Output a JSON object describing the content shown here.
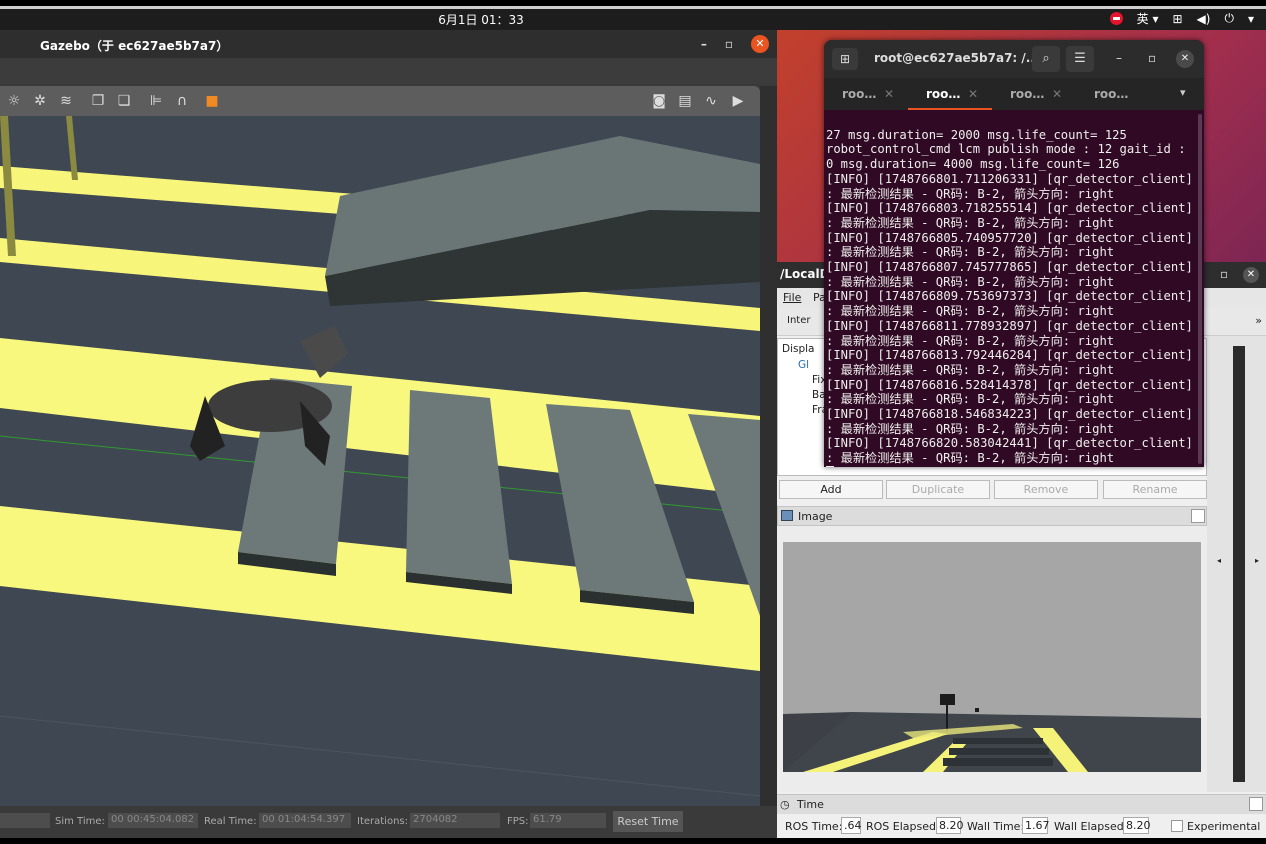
{
  "topbar": {
    "datetime": "6月1日  01：33",
    "input_method": "英 ▾"
  },
  "gazebo": {
    "title": "Gazebo（于 ec627ae5b7a7）",
    "bottom": {
      "sim_time_label": "Sim Time:",
      "sim_time": "00 00:45:04.082",
      "real_time_label": "Real Time:",
      "real_time": "00 01:04:54.397",
      "iterations_label": "Iterations:",
      "iterations": "2704082",
      "fps_label": "FPS:",
      "fps": "61.79",
      "reset_label": "Reset Time"
    }
  },
  "terminal": {
    "title": "root@ec627ae5b7a7: /...",
    "tabs": [
      {
        "label": "roo…"
      },
      {
        "label": "roo…"
      },
      {
        "label": "roo…"
      },
      {
        "label": "roo…"
      }
    ],
    "lines": [
      "27 msg.duration= 2000 msg.life_count= 125",
      "robot_control_cmd lcm publish mode : 12 gait_id :",
      "0 msg.duration= 4000 msg.life_count= 126",
      "[INFO] [1748766801.711206331] [qr_detector_client]",
      ": 最新检测结果 - QR码: B-2, 箭头方向: right",
      "[INFO] [1748766803.718255514] [qr_detector_client]",
      ": 最新检测结果 - QR码: B-2, 箭头方向: right",
      "[INFO] [1748766805.740957720] [qr_detector_client]",
      ": 最新检测结果 - QR码: B-2, 箭头方向: right",
      "[INFO] [1748766807.745777865] [qr_detector_client]",
      ": 最新检测结果 - QR码: B-2, 箭头方向: right",
      "[INFO] [1748766809.753697373] [qr_detector_client]",
      ": 最新检测结果 - QR码: B-2, 箭头方向: right",
      "[INFO] [1748766811.778932897] [qr_detector_client]",
      ": 最新检测结果 - QR码: B-2, 箭头方向: right",
      "[INFO] [1748766813.792446284] [qr_detector_client]",
      ": 最新检测结果 - QR码: B-2, 箭头方向: right",
      "[INFO] [1748766816.528414378] [qr_detector_client]",
      ": 最新检测结果 - QR码: B-2, 箭头方向: right",
      "[INFO] [1748766818.546834223] [qr_detector_client]",
      ": 最新检测结果 - QR码: B-2, 箭头方向: right",
      "[INFO] [1748766820.583042441] [qr_detector_client]",
      ": 最新检测结果 - QR码: B-2, 箭头方向: right"
    ]
  },
  "rviz": {
    "title": "/LocalD",
    "menu": {
      "file": "File",
      "panels": "Pa"
    },
    "toolbar": {
      "interact": "Inter"
    },
    "displays": {
      "header": "Displa",
      "global": "Gl",
      "fixed": "Fix",
      "background": "Ba",
      "frame": "Fra"
    },
    "buttons": {
      "add": "Add",
      "duplicate": "Duplicate",
      "remove": "Remove",
      "rename": "Rename"
    },
    "image_panel": {
      "label": "Image"
    },
    "time_panel": {
      "label": "Time",
      "ros_time_label": "ROS Time:",
      "ros_time": ".64",
      "ros_elapsed_label": "ROS Elapsed:",
      "ros_elapsed": "8.20",
      "wall_time_label": "Wall Time:",
      "wall_time": "1.67",
      "wall_elapsed_label": "Wall Elapsed:",
      "wall_elapsed": "8.20",
      "experimental_label": "Experimental"
    }
  }
}
